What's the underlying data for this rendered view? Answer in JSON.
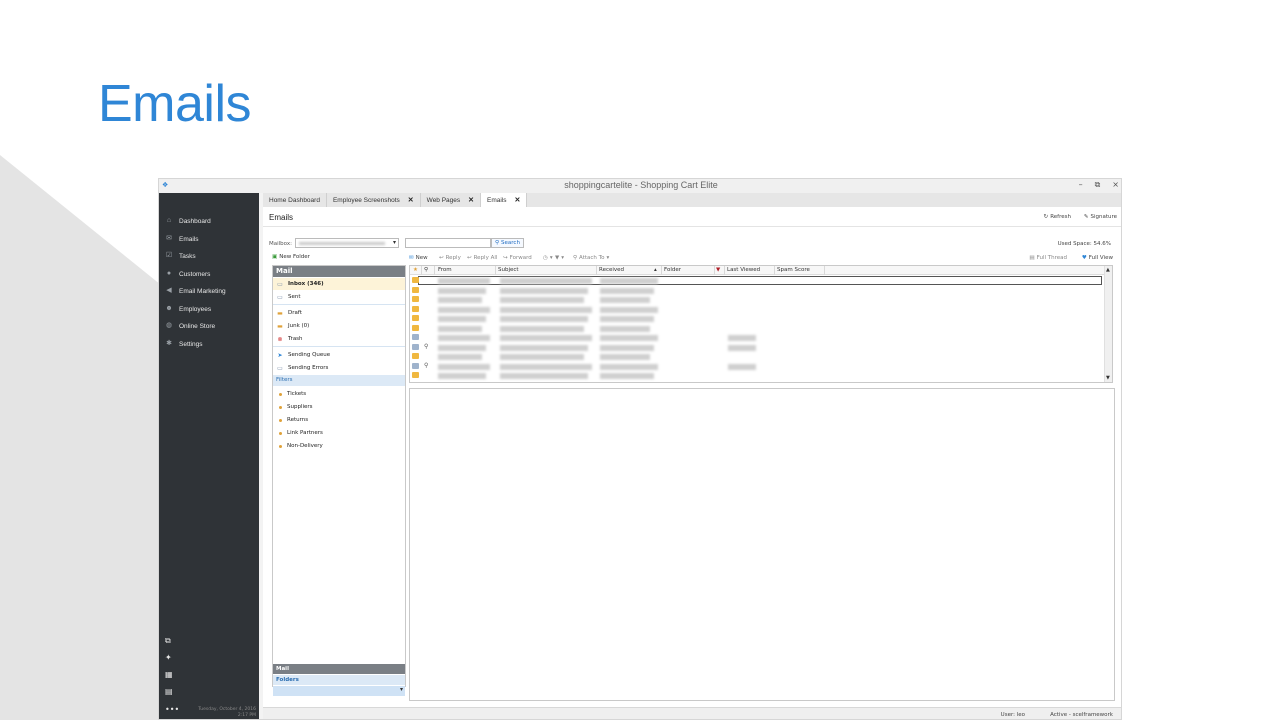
{
  "slide": {
    "title": "Emails"
  },
  "app": {
    "title": "shoppingcartelite - Shopping Cart Elite",
    "window_buttons": [
      "–",
      "⧉",
      "×"
    ]
  },
  "sidebar": {
    "items": [
      {
        "label": "Dashboard",
        "icon": "home-icon"
      },
      {
        "label": "Emails",
        "icon": "mail-icon"
      },
      {
        "label": "Tasks",
        "icon": "tasks-icon"
      },
      {
        "label": "Customers",
        "icon": "user-icon"
      },
      {
        "label": "Email Marketing",
        "icon": "megaphone-icon"
      },
      {
        "label": "Employees",
        "icon": "users-icon"
      },
      {
        "label": "Online Store",
        "icon": "globe-icon"
      },
      {
        "label": "Settings",
        "icon": "gear-icon"
      }
    ],
    "date_line1": "Tuesday, October 4, 2016",
    "date_line2": "2:17 PM"
  },
  "tabs": [
    {
      "label": "Home Dashboard",
      "closable": false
    },
    {
      "label": "Employee Screenshots",
      "closable": true
    },
    {
      "label": "Web Pages",
      "closable": true
    },
    {
      "label": "Emails",
      "closable": true,
      "active": true
    }
  ],
  "page": {
    "title": "Emails",
    "refresh_label": "Refresh",
    "signature_label": "Signature",
    "mailbox_label": "Mailbox:",
    "search_label": "Search",
    "used_space": "Used Space: 54.6%"
  },
  "folders": {
    "new_folder": "New Folder",
    "header": "Mail",
    "inbox": "Inbox (346)",
    "sent": "Sent",
    "draft": "Draft",
    "junk": "Junk (0)",
    "trash": "Trash",
    "sending_queue": "Sending Queue",
    "sending_errors": "Sending Errors",
    "filters_header": "Filters",
    "filters": [
      "Tickets",
      "Suppliers",
      "Returns",
      "Link Partners",
      "Non-Delivery"
    ],
    "bottom_mail": "Mail",
    "bottom_folders": "Folders"
  },
  "mail_toolbar": {
    "new": "New",
    "reply": "Reply",
    "reply_all": "Reply All",
    "forward": "Forward",
    "attach_to": "Attach To",
    "full_thread": "Full Thread",
    "full_view": "Full View"
  },
  "grid": {
    "columns": [
      "From",
      "Subject",
      "Received",
      "Folder",
      "Last Viewed",
      "Spam Score"
    ]
  },
  "status": {
    "user": "User: leo",
    "active": "Active - scelframework"
  }
}
